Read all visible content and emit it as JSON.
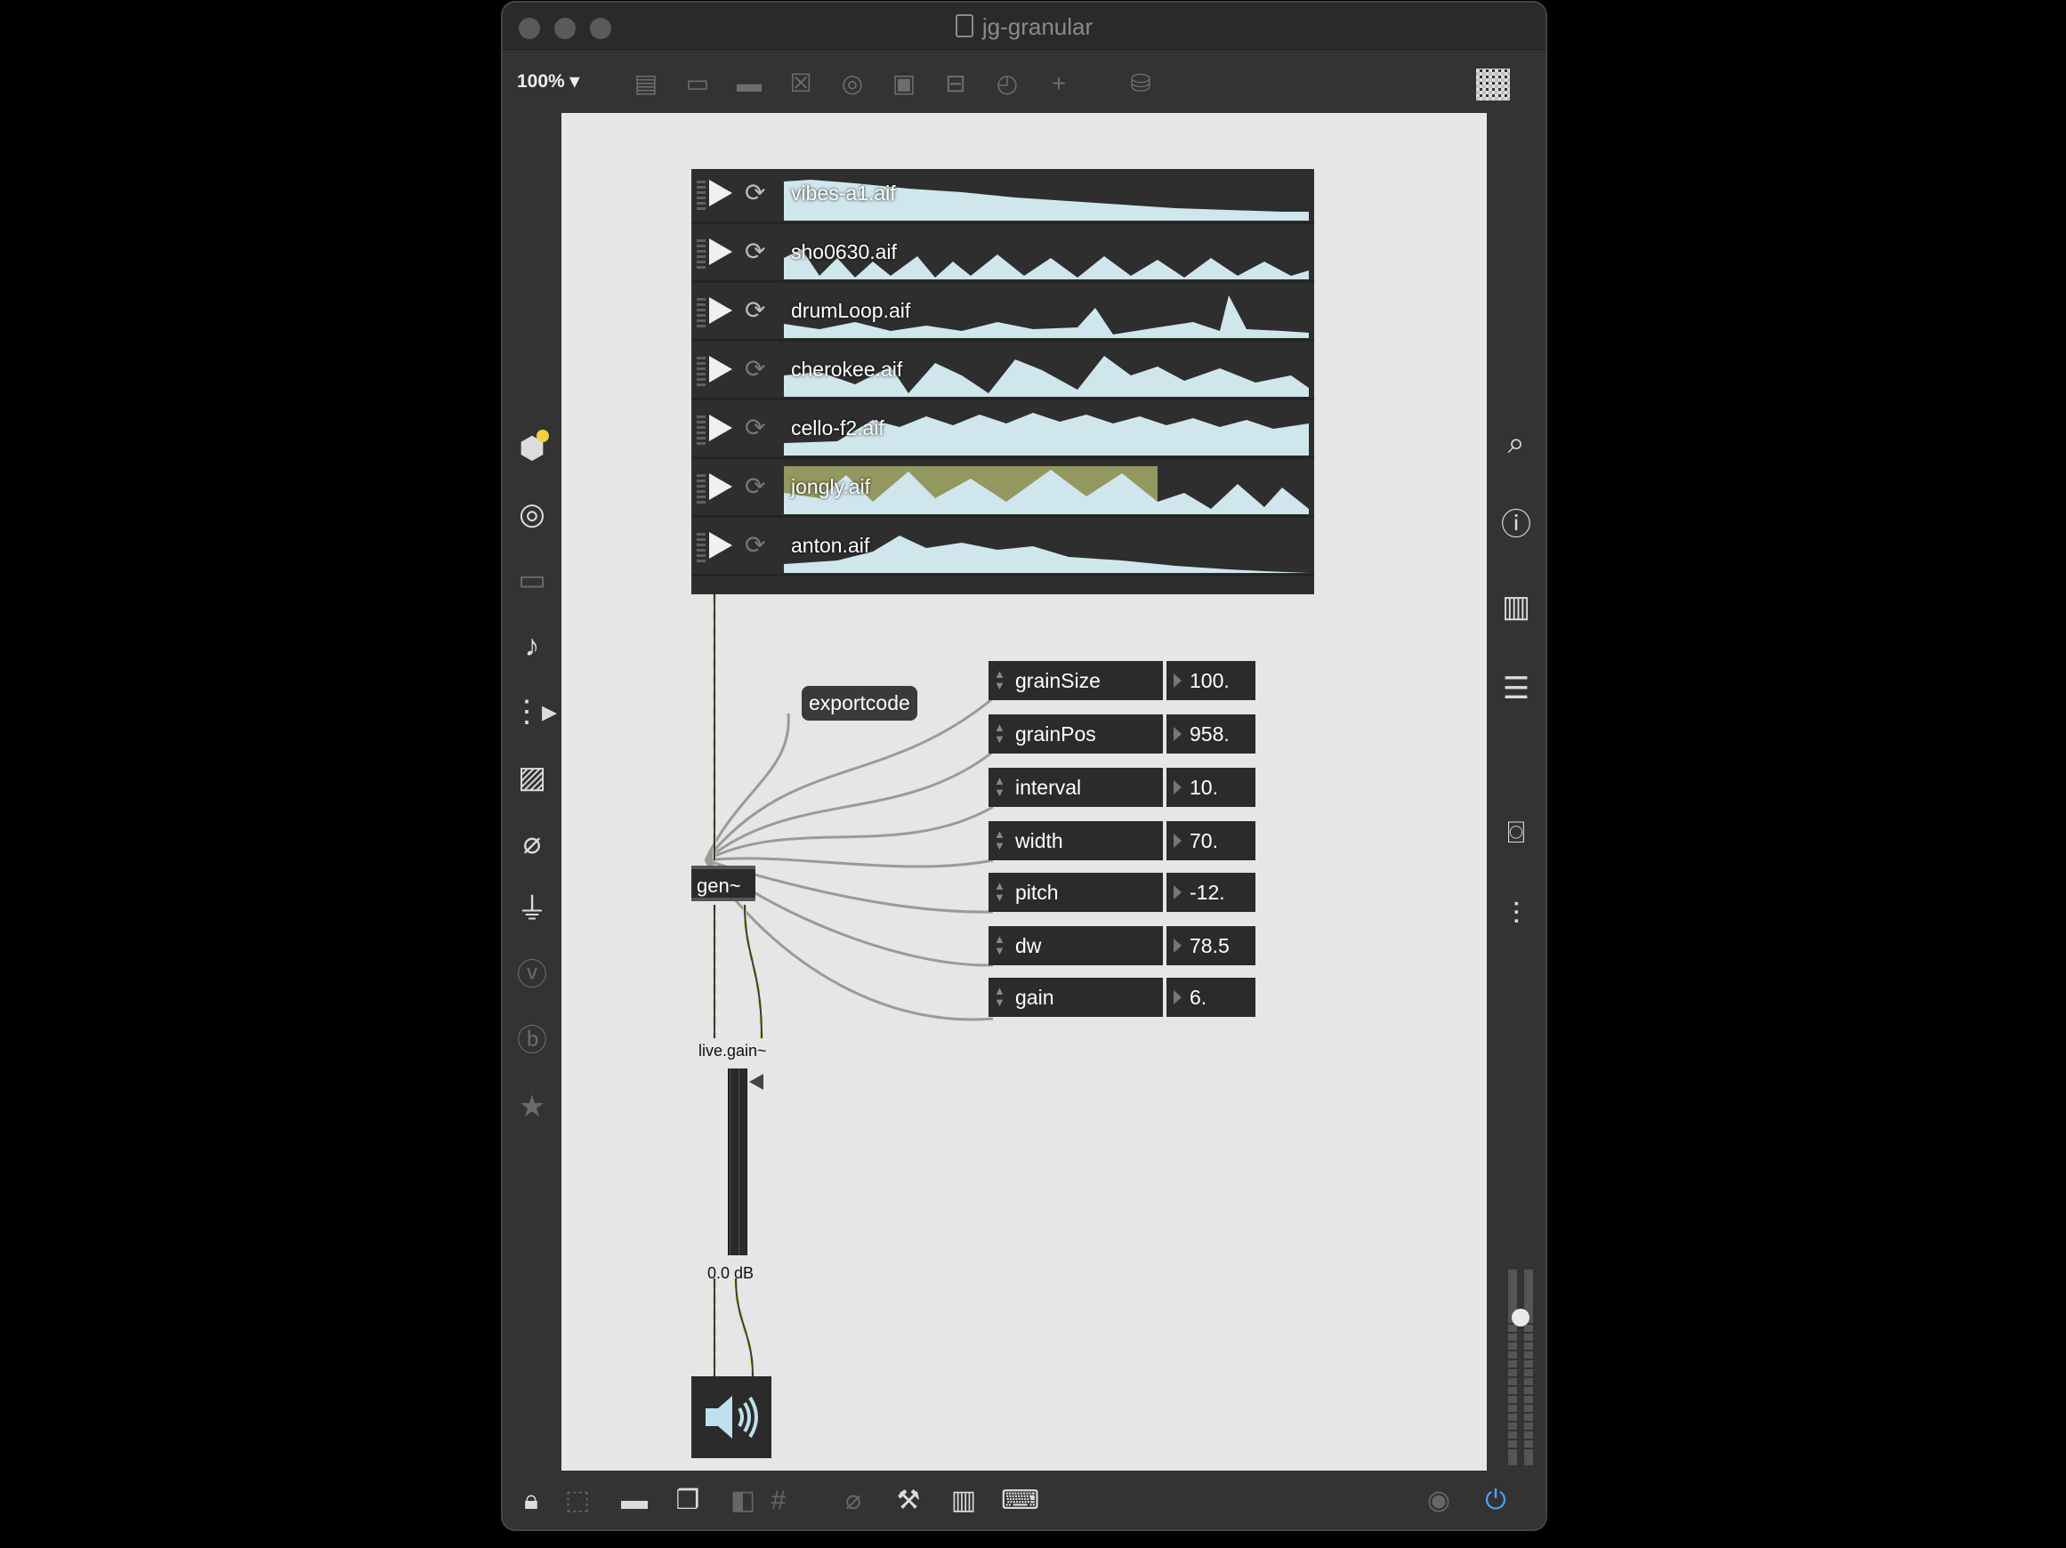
{
  "window": {
    "title": "jg-granular"
  },
  "toolbar": {
    "zoom": "100%"
  },
  "playlist": [
    {
      "file": "vibes-a1.aif",
      "loop_active": true,
      "highlight": false
    },
    {
      "file": "sho0630.aif",
      "loop_active": true,
      "highlight": false
    },
    {
      "file": "drumLoop.aif",
      "loop_active": true,
      "highlight": false
    },
    {
      "file": "cherokee.aif",
      "loop_active": false,
      "highlight": false
    },
    {
      "file": "cello-f2.aif",
      "loop_active": false,
      "highlight": false
    },
    {
      "file": "jongly.aif",
      "loop_active": false,
      "highlight": true
    },
    {
      "file": "anton.aif",
      "loop_active": false,
      "highlight": false
    }
  ],
  "objects": {
    "gen": "gen~",
    "exportcode": "exportcode",
    "live_gain_label": "live.gain~",
    "gain_readout": "0.0 dB"
  },
  "params": [
    {
      "name": "grainSize",
      "value": "100."
    },
    {
      "name": "grainPos",
      "value": "958."
    },
    {
      "name": "interval",
      "value": "10."
    },
    {
      "name": "width",
      "value": "70."
    },
    {
      "name": "pitch",
      "value": "-12."
    },
    {
      "name": "dw",
      "value": "78.5"
    },
    {
      "name": "gain",
      "value": "6."
    }
  ],
  "colors": {
    "canvas": "#e6e6e6",
    "object": "#2b2b2b",
    "waveform": "#cfe6ec",
    "highlight": "#e8ef8a",
    "patchcord": "#9a9a9a",
    "signal_cord": "#d8e07a",
    "power_on": "#4aa3ff"
  },
  "icons": {
    "left": [
      "package-icon",
      "target-icon",
      "device-icon",
      "music-note-icon",
      "sequence-icon",
      "image-icon",
      "paperclip-icon",
      "plug-icon",
      "vst-icon",
      "beap-icon",
      "star-icon"
    ],
    "right": [
      "search-icon",
      "info-icon",
      "book-icon",
      "list-icon",
      "camera-icon",
      "mixer-icon"
    ]
  }
}
